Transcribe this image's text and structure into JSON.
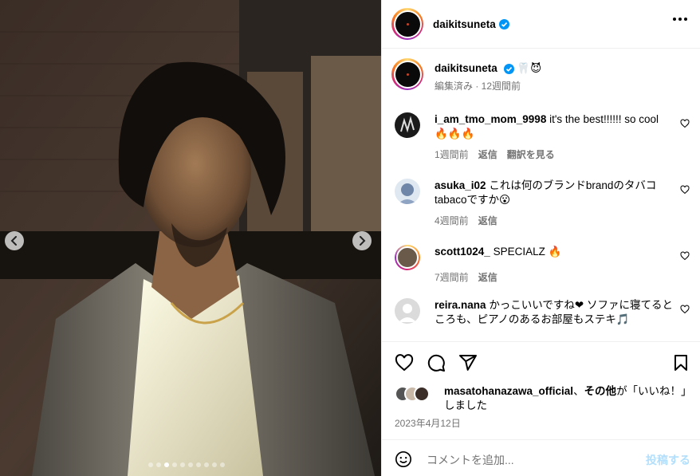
{
  "post": {
    "username": "daikitsuneta",
    "menu_icon": "more-horizontal-icon",
    "carousel": {
      "slide_count": 10,
      "active_index": 2
    }
  },
  "caption": {
    "username": "daikitsuneta",
    "emojis": "🦷😈",
    "meta": "編集済み · 12週間前"
  },
  "comments": [
    {
      "username": "i_am_tmo_mom_9998",
      "text": "it's the best!!!!!! so cool 🔥🔥🔥",
      "time": "1週間前",
      "reply": "返信",
      "translate": "翻訳を見る"
    },
    {
      "username": "asuka_i02",
      "text": "これは何のブランドbrandのタバコtabacoですか😮",
      "time": "4週間前",
      "reply": "返信"
    },
    {
      "username": "scott1024_",
      "text": "SPECIALZ 🔥",
      "time": "7週間前",
      "reply": "返信"
    },
    {
      "username": "reira.nana",
      "text": "かっこいいですね❤ ソファに寝てるところも、ピアノのあるお部屋もステキ🎵"
    }
  ],
  "likes": {
    "user": "masatohanazawa_official",
    "sep": "、",
    "others": "その他",
    "suffix": "が「いいね！」しました"
  },
  "date": "2023年4月12日",
  "add_comment": {
    "placeholder": "コメントを追加...",
    "post_label": "投稿する"
  },
  "colors": {
    "verified": "#0095f6",
    "link": "#b2dffc",
    "muted": "#737373"
  }
}
